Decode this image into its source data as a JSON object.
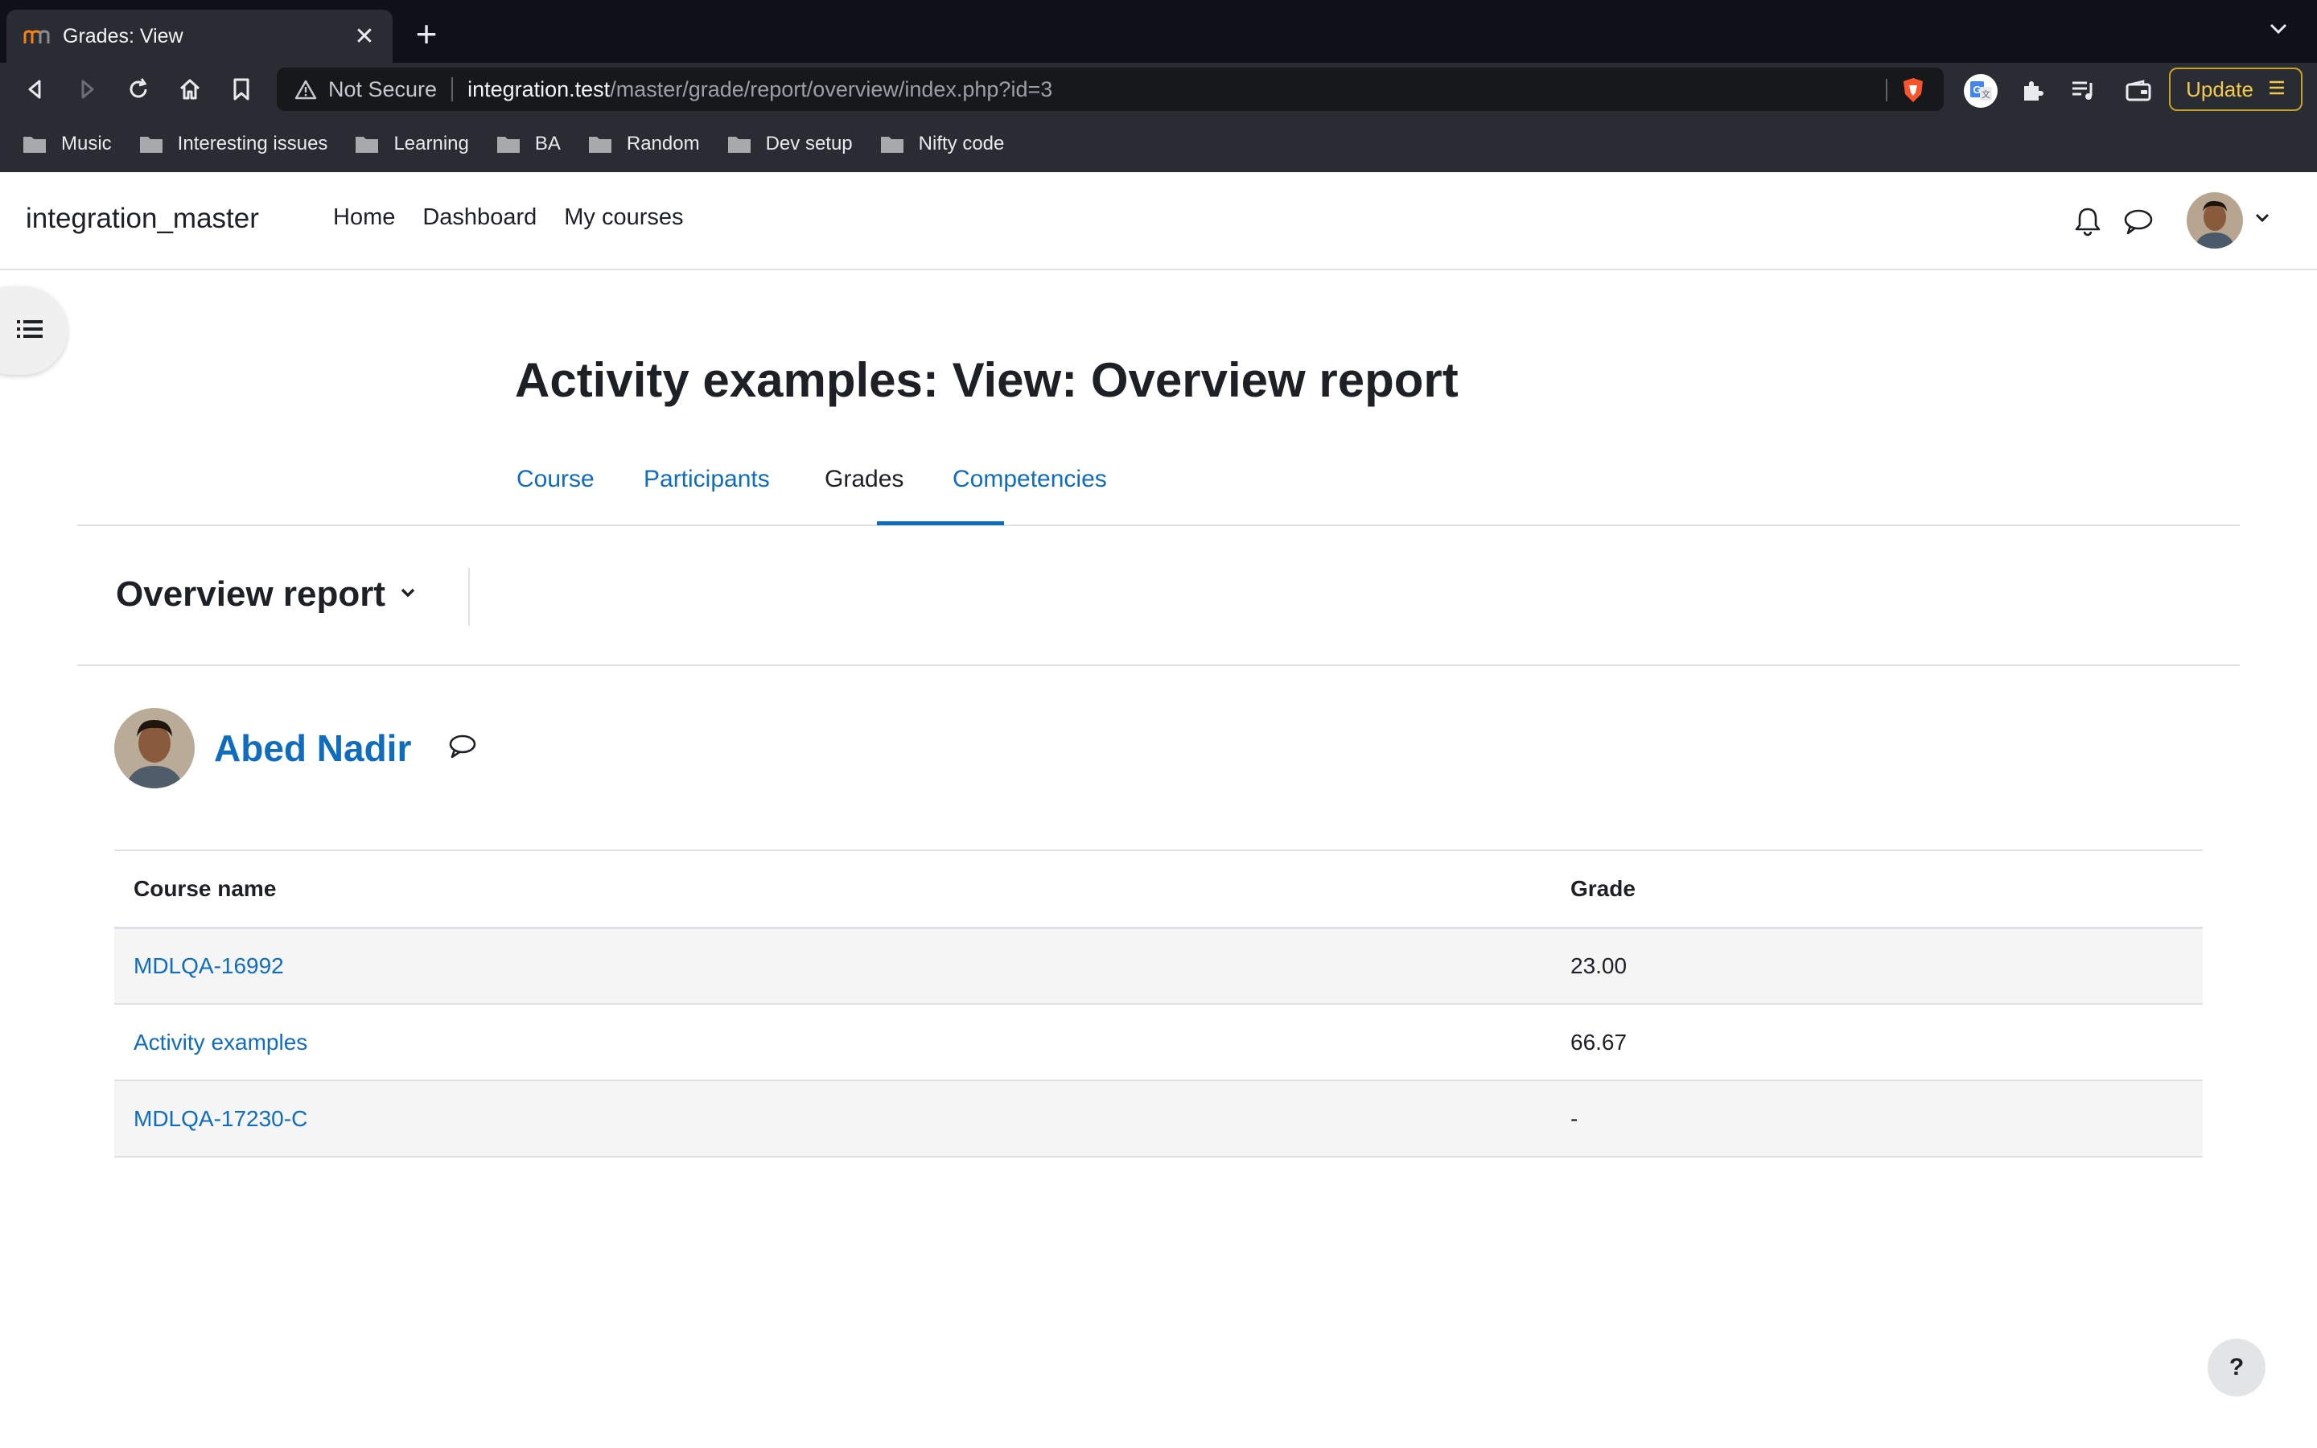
{
  "browser": {
    "tab_title": "Grades: View",
    "tab_close": "✕",
    "new_tab": "+",
    "address": {
      "security_label": "Not Secure",
      "host": "integration.test",
      "path": "/master/grade/report/overview/index.php?id=3"
    },
    "update_label": "Update",
    "bookmarks": [
      {
        "label": "Music"
      },
      {
        "label": "Interesting issues"
      },
      {
        "label": "Learning"
      },
      {
        "label": "BA"
      },
      {
        "label": "Random"
      },
      {
        "label": "Dev setup"
      },
      {
        "label": "Nifty code"
      }
    ]
  },
  "site": {
    "name": "integration_master",
    "primary_nav": [
      "Home",
      "Dashboard",
      "My courses"
    ]
  },
  "page": {
    "title": "Activity examples: View: Overview report",
    "tabs": [
      {
        "label": "Course",
        "active": false
      },
      {
        "label": "Participants",
        "active": false
      },
      {
        "label": "Grades",
        "active": true
      },
      {
        "label": "Competencies",
        "active": false
      }
    ],
    "report_selector": "Overview report",
    "user": {
      "name": "Abed Nadir"
    },
    "table": {
      "headers": [
        "Course name",
        "Grade"
      ],
      "rows": [
        {
          "course": "MDLQA-16992",
          "grade": "23.00"
        },
        {
          "course": "Activity examples",
          "grade": "66.67"
        },
        {
          "course": "MDLQA-17230-C",
          "grade": "-"
        }
      ]
    },
    "help_label": "?"
  },
  "colors": {
    "link": "#0f6cbf",
    "text": "#1d2125",
    "browser_dark": "#0f111a",
    "browser_toolbar": "#2a2c33",
    "update_accent": "#f2c94c"
  },
  "icons": {
    "back": "arrow-left-icon",
    "forward": "arrow-right-icon",
    "reload": "reload-icon",
    "home": "home-icon",
    "bookmark": "bookmark-icon",
    "warning": "warning-icon",
    "shield": "brave-shield-icon",
    "notifications": "bell-icon",
    "messages": "chat-icon",
    "drawer": "list-icon",
    "help": "question-icon"
  }
}
